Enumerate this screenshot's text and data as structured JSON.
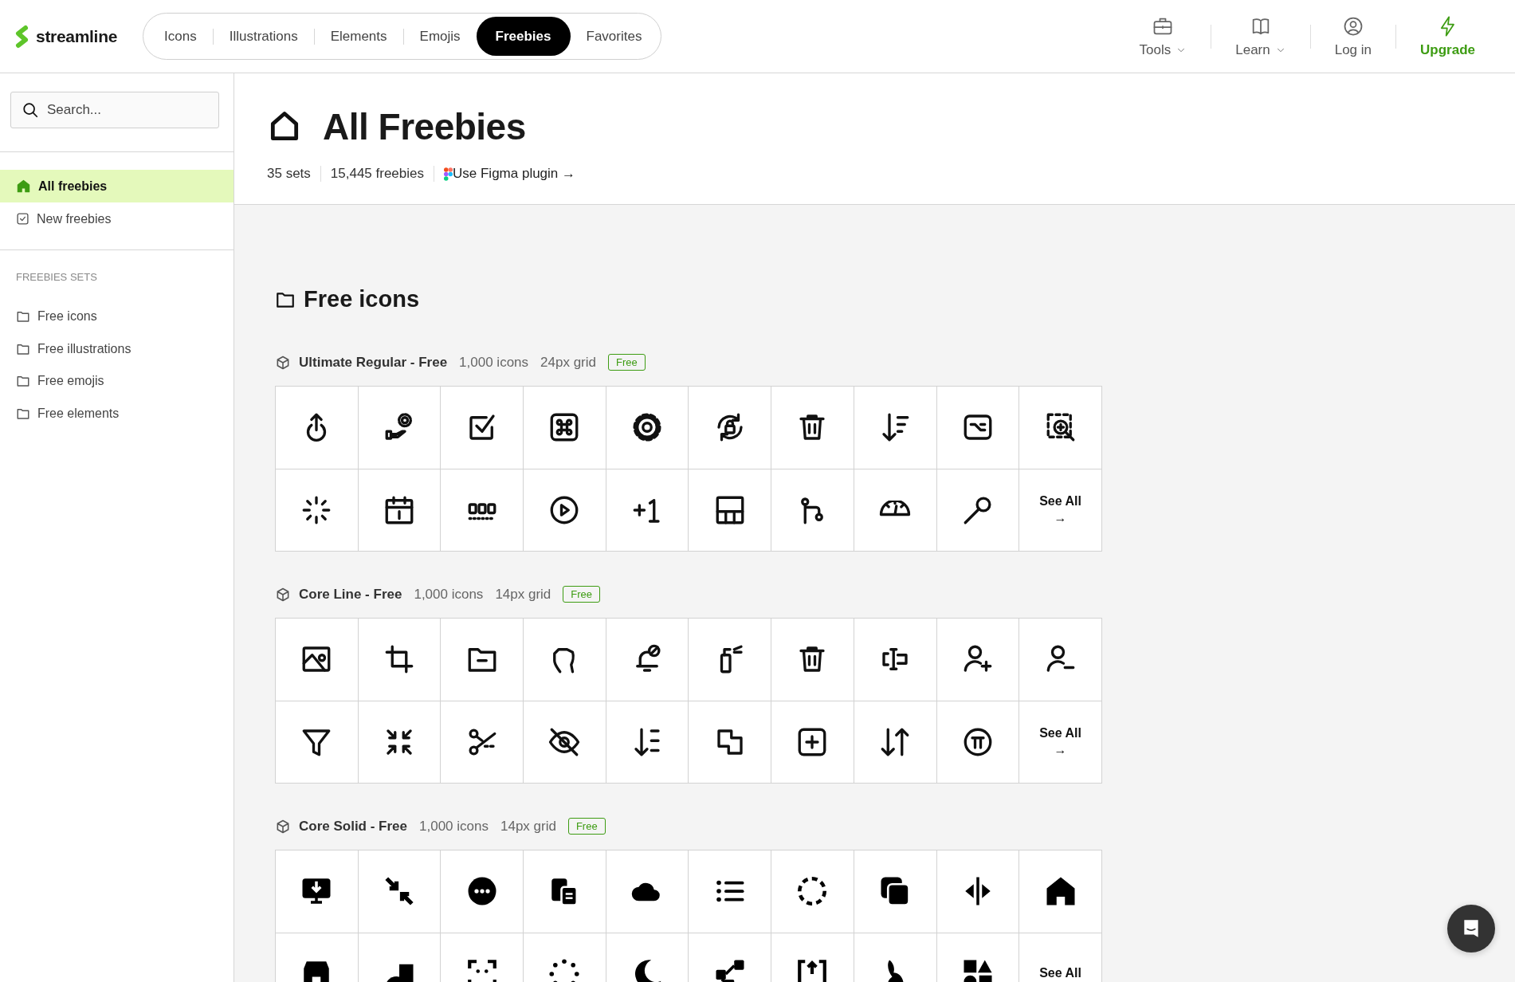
{
  "header": {
    "logo": "streamline",
    "nav": [
      {
        "label": "Icons",
        "selected": false
      },
      {
        "label": "Illustrations",
        "selected": false
      },
      {
        "label": "Elements",
        "selected": false
      },
      {
        "label": "Emojis",
        "selected": false
      },
      {
        "label": "Freebies",
        "selected": true
      },
      {
        "label": "Favorites",
        "selected": false
      }
    ],
    "right_nav": [
      {
        "label": "Tools",
        "has_menu": true,
        "highlight": false
      },
      {
        "label": "Learn",
        "has_menu": true,
        "highlight": false
      },
      {
        "label": "Log in",
        "has_menu": false,
        "highlight": false
      },
      {
        "label": "Upgrade",
        "has_menu": false,
        "highlight": true
      }
    ]
  },
  "sidebar": {
    "search": {
      "placeholder": "Search..."
    },
    "items": [
      {
        "label": "All freebies",
        "selected": true
      },
      {
        "label": "New freebies",
        "selected": false
      }
    ],
    "sets_heading": "FREEBIES SETS",
    "sets": [
      {
        "label": "Free icons"
      },
      {
        "label": "Free illustrations"
      },
      {
        "label": "Free emojis"
      },
      {
        "label": "Free elements"
      }
    ]
  },
  "page": {
    "title": "All Freebies",
    "stats": [
      "35 sets",
      "15,445 freebies"
    ],
    "plugin_link": "Use Figma plugin →"
  },
  "section": {
    "title": "Free icons",
    "sets": [
      {
        "name": "Ultimate Regular - Free",
        "count": "1,000 icons",
        "grid": "24px grid",
        "badge": "Free",
        "see_all": "See All",
        "see_all_arrow": "→"
      },
      {
        "name": "Core Line - Free",
        "count": "1,000 icons",
        "grid": "14px grid",
        "badge": "Free",
        "see_all": "See All",
        "see_all_arrow": "→"
      },
      {
        "name": "Core Solid - Free",
        "count": "1,000 icons",
        "grid": "14px grid",
        "badge": "Free",
        "see_all": "See All"
      }
    ]
  }
}
